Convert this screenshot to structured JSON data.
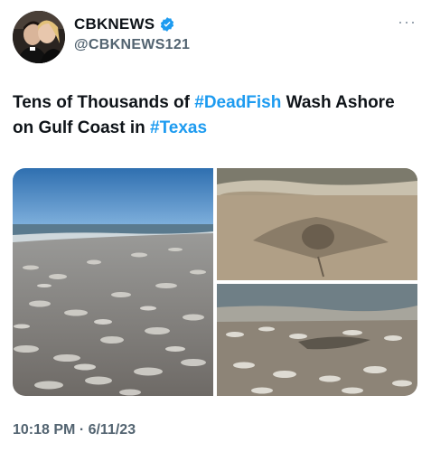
{
  "author": {
    "display_name": "CBKNEWS",
    "handle": "@CBKNEWS121",
    "verified_icon": "verified-badge-icon",
    "avatar_icon": "profile-avatar"
  },
  "more_label": "···",
  "tweet": {
    "text_parts": [
      {
        "text": "Tens of Thousands of ",
        "hashtag": false
      },
      {
        "text": "#DeadFish",
        "hashtag": true
      },
      {
        "text": " Wash Ashore on Gulf Coast in ",
        "hashtag": false
      },
      {
        "text": "#Texas",
        "hashtag": true
      }
    ]
  },
  "media": {
    "photos": [
      "beach-dead-fish-photo",
      "stingray-shore-photo",
      "fish-shoreline-photo"
    ]
  },
  "timestamp": "10:18 PM · 6/11/23",
  "colors": {
    "accent": "#1d9bf0",
    "muted": "#536471",
    "text": "#0f1419"
  }
}
